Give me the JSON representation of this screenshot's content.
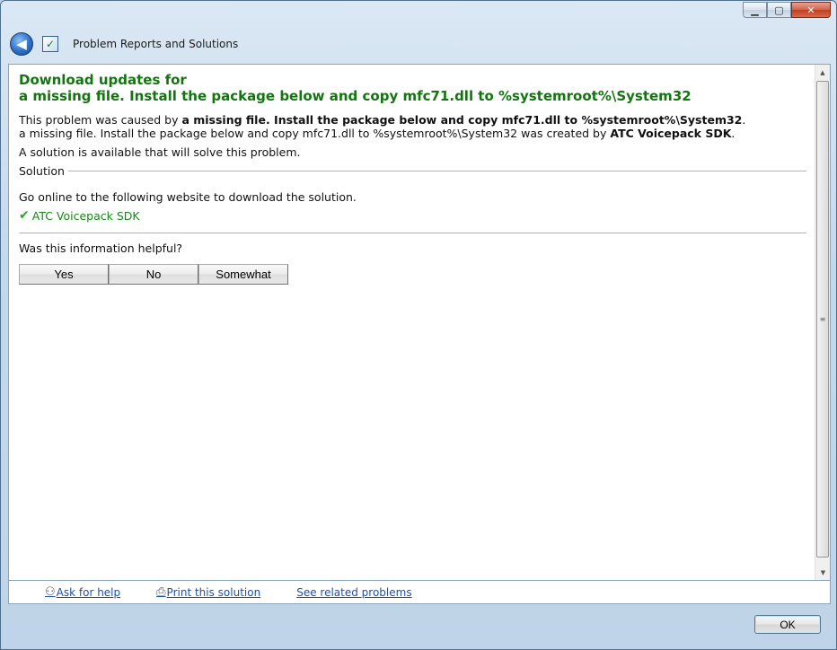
{
  "window": {
    "title": "Problem Reports and Solutions",
    "caption_buttons": {
      "minimize": "▁",
      "maximize": "▢",
      "close": "✕"
    },
    "back_icon": "◀"
  },
  "content": {
    "headline_line1": "Download updates for",
    "headline_line2": "a missing file. Install the package below and copy mfc71.dll to %systemroot%\\System32",
    "cause_prefix": "This problem was caused by ",
    "cause_bold": "a missing file. Install the package below and copy mfc71.dll to %systemroot%\\System32",
    "cause_suffix": ".",
    "created_text": "a missing file. Install the package below and copy mfc71.dll to %systemroot%\\System32 was created by ",
    "created_by": "ATC Voicepack SDK",
    "created_suffix": ".",
    "solution_available": "A solution is available that will solve this problem.",
    "solution_header": "Solution",
    "go_online": "Go online to the following website to download the solution.",
    "solution_link": "ATC Voicepack SDK",
    "helpful_question": "Was this information helpful?",
    "feedback_buttons": [
      "Yes",
      "No",
      "Somewhat"
    ]
  },
  "links": {
    "ask_for_help": "Ask for help",
    "print_solution": "Print this solution",
    "see_related": "See related problems"
  },
  "ok_label": "OK"
}
